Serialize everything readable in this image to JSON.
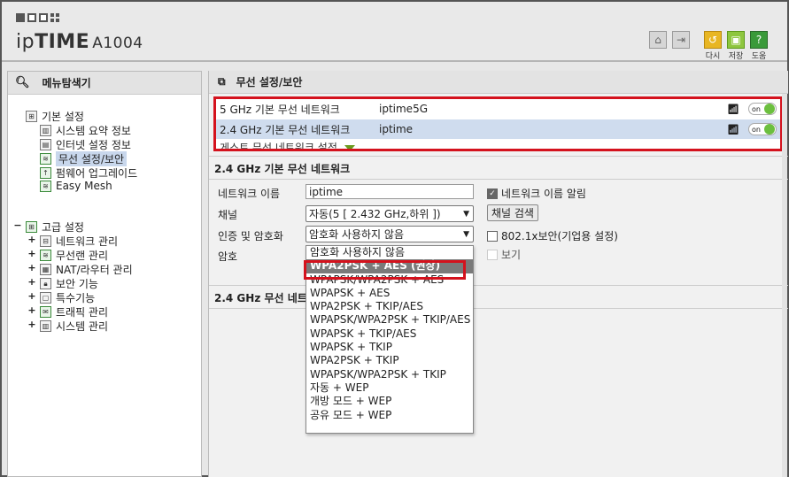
{
  "header": {
    "brand_ip": "ip",
    "brand_time": "TIME",
    "model": "A1004",
    "buttons": [
      {
        "icon": "home-icon",
        "label": ""
      },
      {
        "icon": "logout-icon",
        "label": ""
      },
      {
        "icon": "undo-icon",
        "label": "다시"
      },
      {
        "icon": "save-icon",
        "label": "저장"
      },
      {
        "icon": "help-icon",
        "label": "도움"
      }
    ]
  },
  "left": {
    "title": "메뉴탐색기",
    "basic": {
      "label": "기본 설정",
      "items": [
        "시스템 요약 정보",
        "인터넷 설정 정보",
        "무선 설정/보안",
        "펌웨어 업그레이드",
        "Easy Mesh"
      ]
    },
    "advanced": {
      "label": "고급 설정",
      "items": [
        "네트워크 관리",
        "무선랜 관리",
        "NAT/라우터 관리",
        "보안 기능",
        "특수기능",
        "트래픽 관리",
        "시스템 관리"
      ]
    }
  },
  "right": {
    "title": "무선 설정/보안",
    "networks": [
      {
        "name": "5 GHz 기본 무선 네트워크",
        "ssid": "iptime5G",
        "toggle": "on"
      },
      {
        "name": "2.4 GHz 기본 무선 네트워크",
        "ssid": "iptime",
        "toggle": "on"
      }
    ],
    "guest_label": "게스트 무선 네트워크 설정",
    "section_title": "2.4 GHz 기본 무선 네트워크",
    "form": {
      "network_name_label": "네트워크 이름",
      "network_name_value": "iptime",
      "broadcast_label": "네트워크 이름 알림",
      "channel_label": "채널",
      "channel_value": "자동(5 [ 2.432 GHz,하위 ])",
      "channel_scan": "채널 검색",
      "auth_label": "인증 및 암호화",
      "auth_value": "암호화 사용하지 않음",
      "enterprise_label": "802.1x보안(기업용 설정)",
      "password_label": "암호",
      "show_label": "보기"
    },
    "dropdown_options": [
      "암호화 사용하지 않음",
      "WPA2PSK + AES (권장)",
      "WPAPSK/WPA2PSK + AES",
      "WPAPSK + AES",
      "WPA2PSK + TKIP/AES",
      "WPAPSK/WPA2PSK + TKIP/AES",
      "WPAPSK + TKIP/AES",
      "WPAPSK + TKIP",
      "WPA2PSK + TKIP",
      "WPAPSK/WPA2PSK + TKIP",
      "자동 + WEP",
      "개방 모드 + WEP",
      "공유 모드 + WEP"
    ],
    "section2_title": "2.4 GHz 무선 네트"
  },
  "colors": {
    "highlight_red": "#d4121d",
    "toggle_green": "#6cbf3f",
    "selected_row": "#cfdcee"
  }
}
